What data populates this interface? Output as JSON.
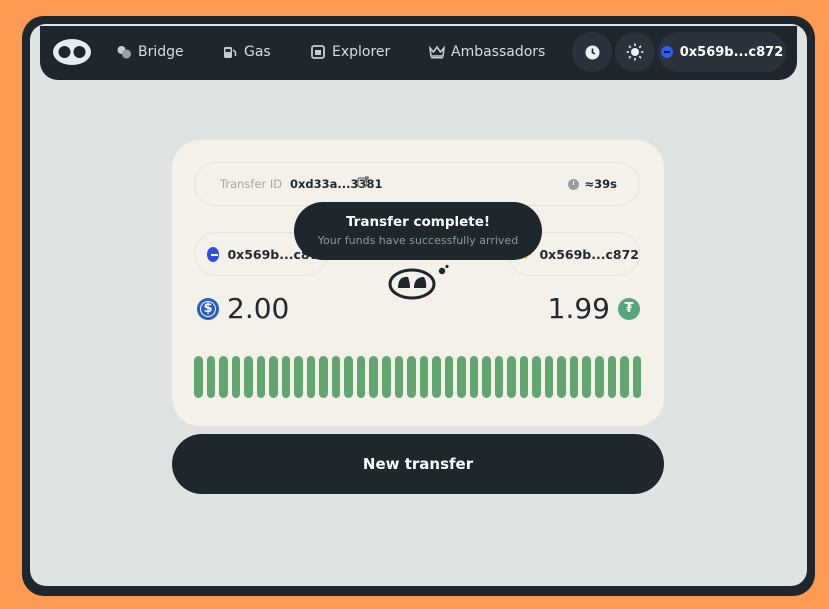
{
  "nav": {
    "items": [
      {
        "label": "Bridge",
        "icon": "bridge-icon"
      },
      {
        "label": "Gas",
        "icon": "gas-pump-icon"
      },
      {
        "label": "Explorer",
        "icon": "explorer-icon"
      },
      {
        "label": "Ambassadors",
        "icon": "crown-icon"
      }
    ],
    "history_icon": "clock-icon",
    "theme_icon": "sun-icon",
    "wallet": "0x569b...c872"
  },
  "transfer": {
    "id_label": "Transfer ID",
    "id_value": "0xd33a...3381",
    "eta": "≈39s",
    "from_address": "0x569b...c872",
    "to_address": "0x569b...c872",
    "from_amount": "2.00",
    "from_token_symbol": "$",
    "to_amount": "1.99",
    "to_token_symbol": "₮",
    "progress_fraction": 1.0
  },
  "toast": {
    "title": "Transfer complete!",
    "subtitle": "Your funds have successfully arrived"
  },
  "actions": {
    "new_transfer": "New transfer"
  },
  "colors": {
    "dark": "#1f272e",
    "accent_green": "#63a56f",
    "card_bg": "#f4f1ea",
    "page_bg": "#dfe3e1",
    "outer_bg": "#ff9a52"
  }
}
